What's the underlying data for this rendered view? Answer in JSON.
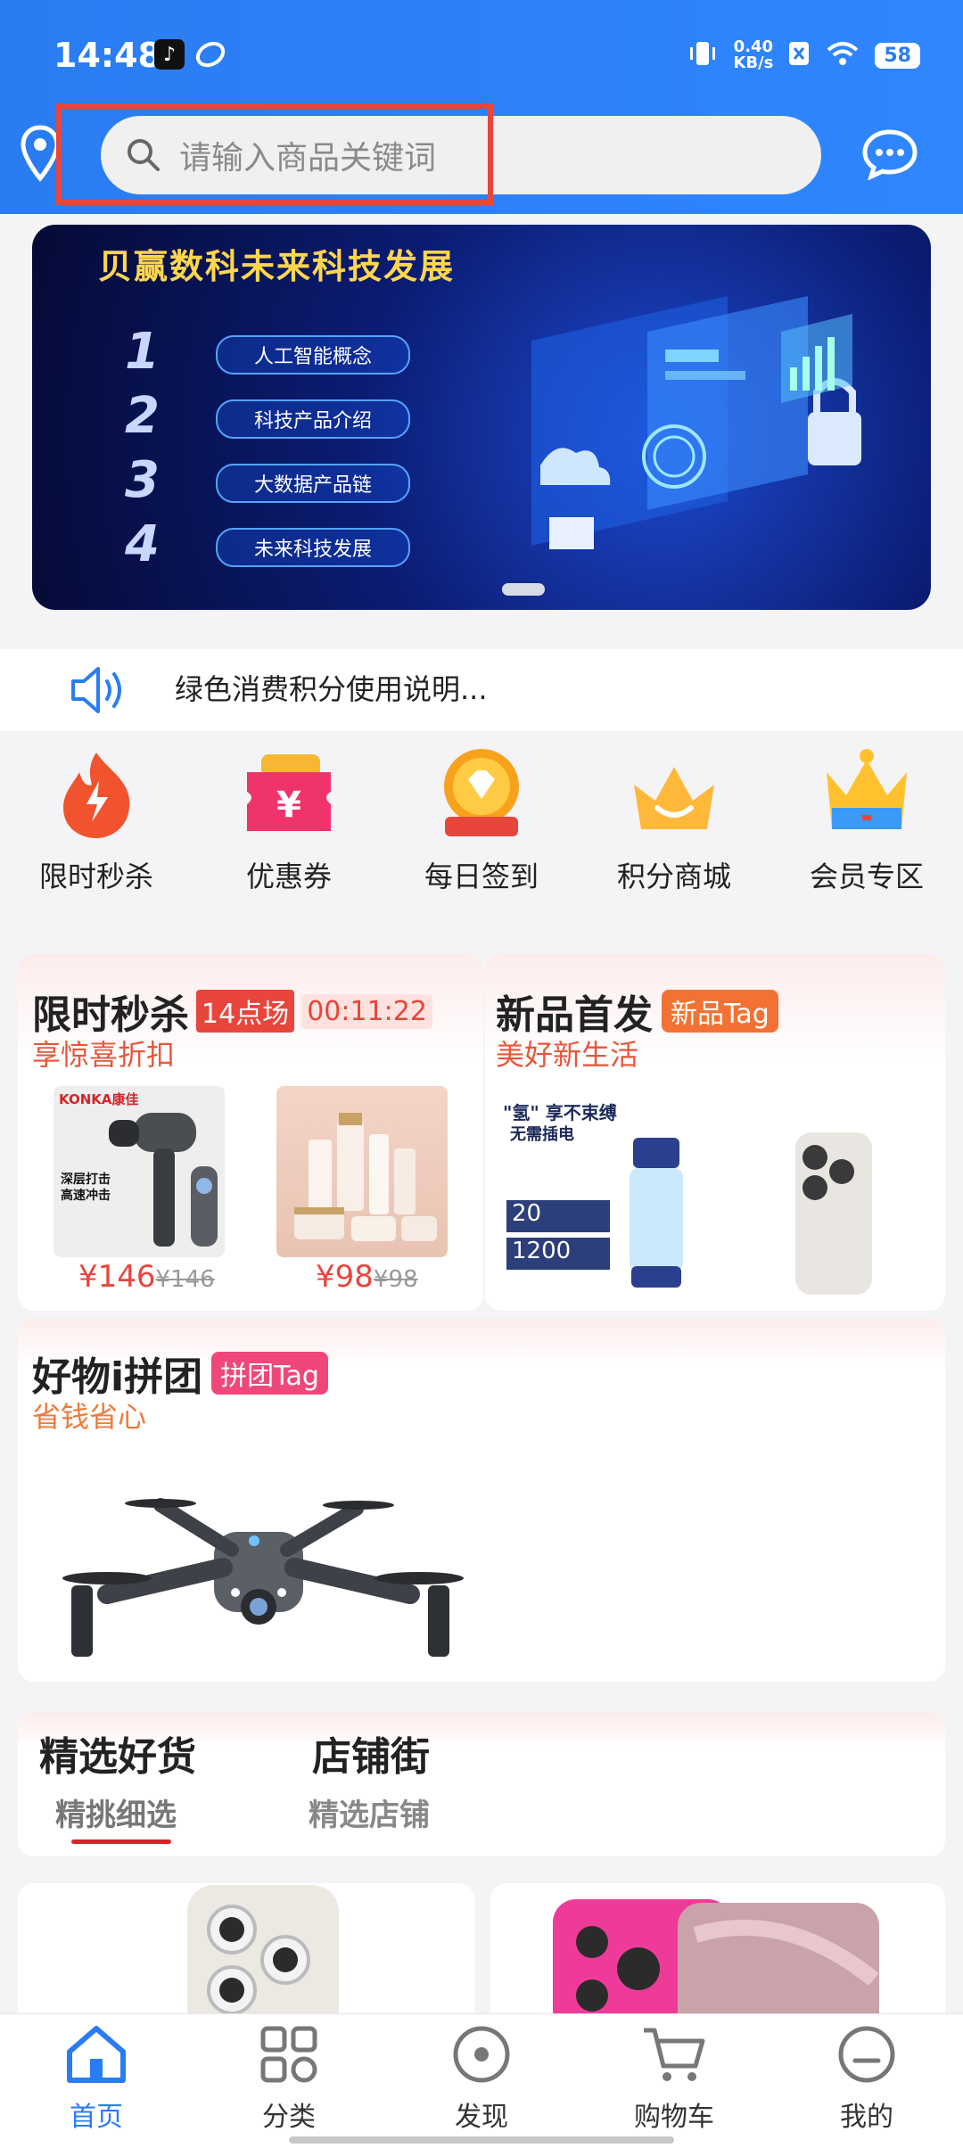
{
  "status_bar": {
    "time": "14:48",
    "net_speed_value": "0.40",
    "net_speed_unit": "KB/s",
    "battery": "58",
    "icons": [
      "tiktok-icon",
      "app-icon",
      "vibrate-icon",
      "sim-off-icon",
      "wifi-icon"
    ]
  },
  "search": {
    "placeholder": "请输入商品关键词"
  },
  "banner": {
    "title": "贝赢数科未来科技发展",
    "items": [
      {
        "num": "1",
        "label": "人工智能概念"
      },
      {
        "num": "2",
        "label": "科技产品介绍"
      },
      {
        "num": "3",
        "label": "大数据产品链"
      },
      {
        "num": "4",
        "label": "未来科技发展"
      }
    ]
  },
  "notice": {
    "text": "绿色消费积分使用说明..."
  },
  "quick_menu": [
    {
      "label": "限时秒杀",
      "icon": "flame-icon"
    },
    {
      "label": "优惠券",
      "icon": "coupon-icon"
    },
    {
      "label": "每日签到",
      "icon": "diamond-medal-icon"
    },
    {
      "label": "积分商城",
      "icon": "crown-smile-icon"
    },
    {
      "label": "会员专区",
      "icon": "vip-crown-icon"
    }
  ],
  "flash_sale": {
    "title": "限时秒杀",
    "session_tag": "14点场",
    "timer": "00:11:22",
    "subtitle": "享惊喜折扣",
    "products": [
      {
        "price": "¥146",
        "old_price": "¥146",
        "brand": "KONKA康佳",
        "lines": [
          "深层打击",
          "高速冲击"
        ]
      },
      {
        "price": "¥98",
        "old_price": "¥98"
      }
    ]
  },
  "new_arrivals": {
    "title": "新品首发",
    "tag": "新品Tag",
    "subtitle": "美好新生活",
    "product_text": {
      "headline": "\"氢\" 享不束缚",
      "sub": "无需插电",
      "stat1_num": "20",
      "stat2_num": "1200"
    }
  },
  "group_buy": {
    "title": "好物i拼团",
    "tag": "拼团Tag",
    "subtitle": "省钱省心"
  },
  "tabs": [
    {
      "title": "精选好货",
      "sub": "精挑细选"
    },
    {
      "title": "店铺街",
      "sub": "精选店铺"
    }
  ],
  "bottom_nav": [
    {
      "label": "首页",
      "icon": "home-icon"
    },
    {
      "label": "分类",
      "icon": "category-icon"
    },
    {
      "label": "发现",
      "icon": "discover-icon"
    },
    {
      "label": "购物车",
      "icon": "cart-icon"
    },
    {
      "label": "我的",
      "icon": "profile-icon"
    }
  ],
  "colors": {
    "primary": "#2a7cf2",
    "accent_red": "#e8453c",
    "accent_orange": "#f37233",
    "accent_pink": "#f0477a"
  }
}
